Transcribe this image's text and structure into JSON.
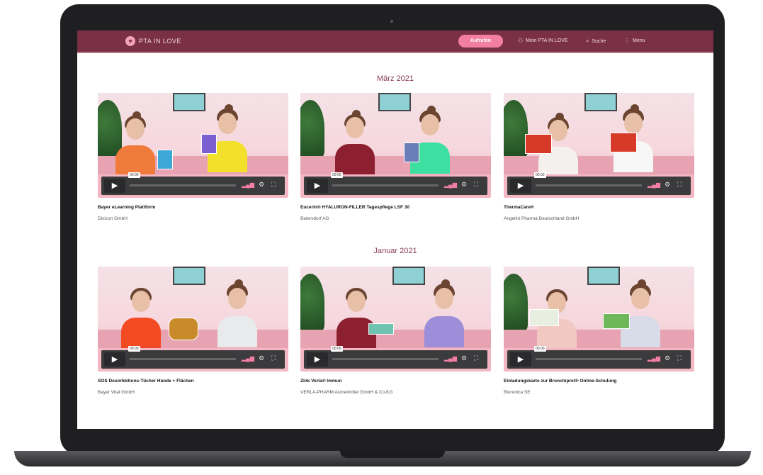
{
  "nav": {
    "logo_text": "PTA IN LOVE",
    "cta_label": "Aufrufen",
    "items": [
      {
        "icon": "user-icon",
        "glyph": "⚇",
        "label": "Mein PTA IN LOVE"
      },
      {
        "icon": "search-icon",
        "glyph": "⌕",
        "label": "Suche"
      },
      {
        "icon": "menu-icon",
        "glyph": "⋮",
        "label": "Menu"
      }
    ]
  },
  "sections": [
    {
      "month": "März 2021",
      "videos": [
        {
          "title": "Bayer eLearning Plattform",
          "company": "Dixicon GmbH",
          "time": "00:00"
        },
        {
          "title": "Eucerin® HYALURON-FILLER Tagespflege LSF 30",
          "company": "Beiersdorf AG",
          "time": "00:00"
        },
        {
          "title": "ThermaCare®",
          "company": "Angelini Pharma Deutschland GmbH",
          "time": "00:00"
        }
      ]
    },
    {
      "month": "Januar 2021",
      "videos": [
        {
          "title": "SOS Desinfektions-Tücher Hände + Flächen",
          "company": "Bayer Vital GmbH",
          "time": "00:00"
        },
        {
          "title": "Zink Verla® Immun",
          "company": "VERLA-PHARM Arzneimittel GmbH & Co.KG",
          "time": "00:00"
        },
        {
          "title": "Einladungskarte zur Bronchipret® Online-Schulung",
          "company": "Bionorica SE",
          "time": "00:00"
        }
      ]
    }
  ],
  "colors": {
    "brand": "#7a3045",
    "accent": "#f27fa3",
    "thumb_border": "#f3b7c4"
  }
}
